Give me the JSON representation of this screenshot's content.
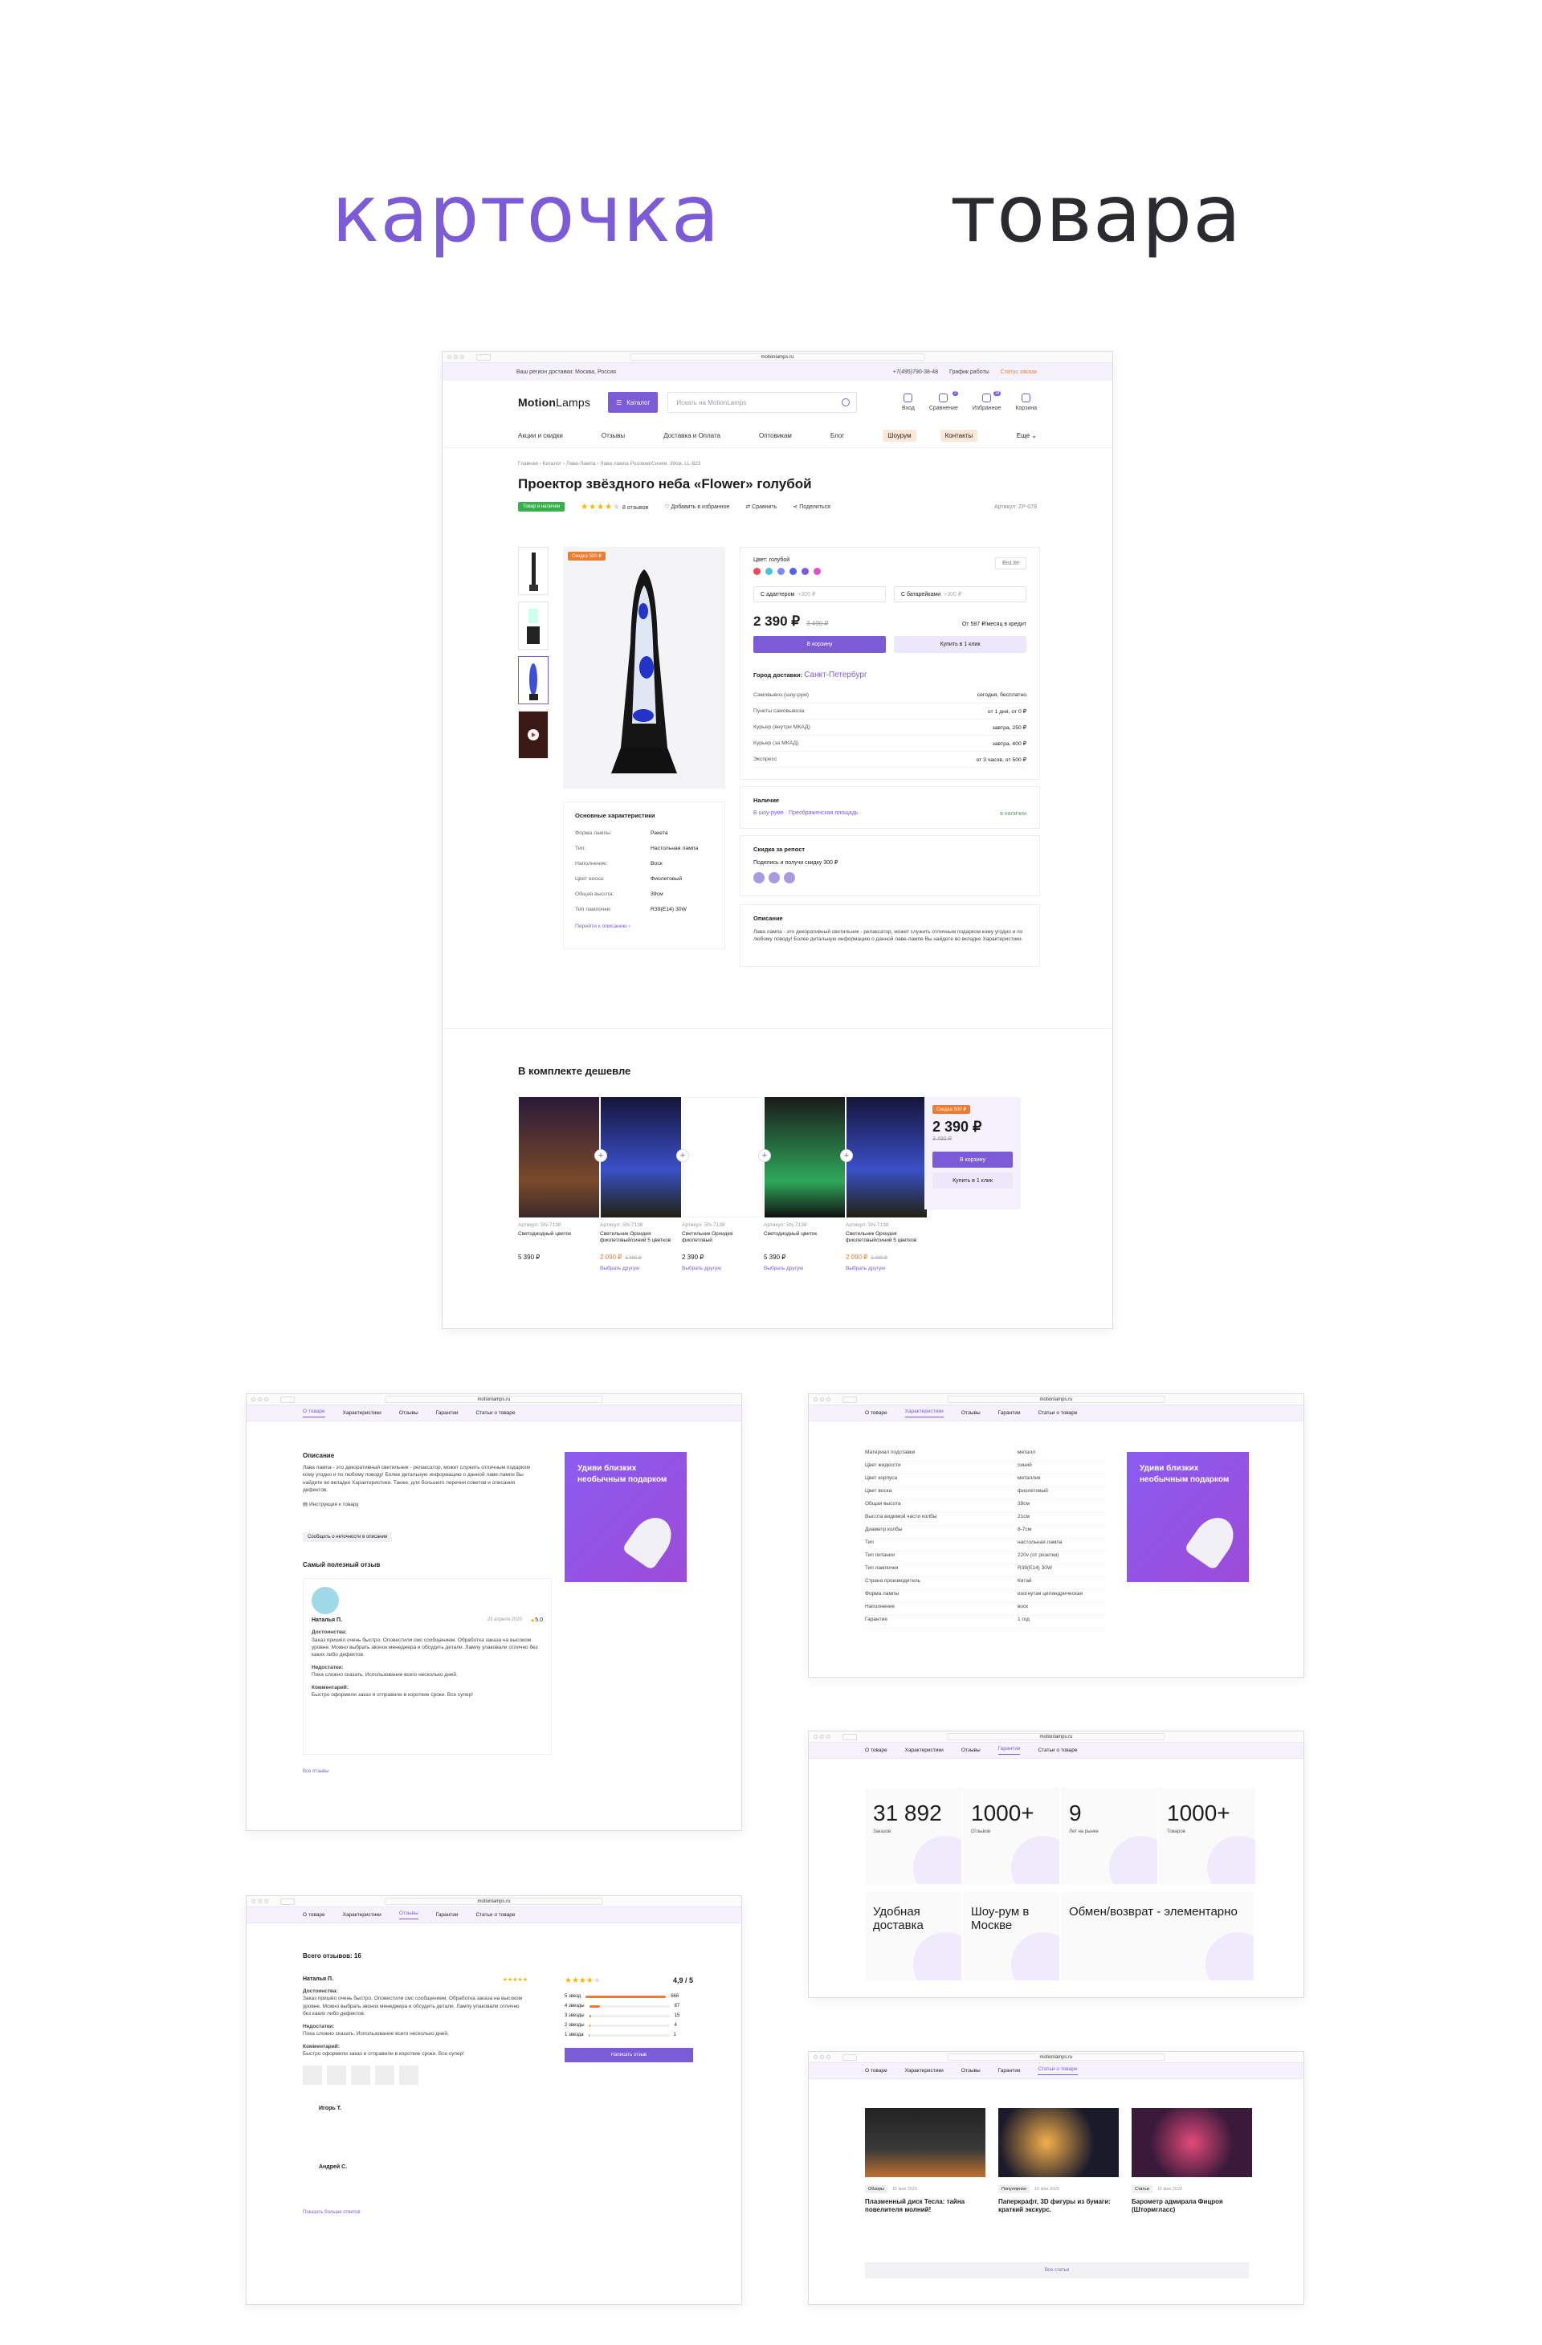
{
  "hero": {
    "word1": "карточка",
    "word2": "товара"
  },
  "url": "motionlamps.ru",
  "main": {
    "topbar": {
      "region": "Ваш регион доставки: Москва, Россия",
      "phone": "+7(495)790-38-48",
      "schedule": "График работы",
      "order": "Статус заказа"
    },
    "header": {
      "logo_a": "Motion",
      "logo_b": "Lamps",
      "catalog": "Каталог",
      "search_placeholder": "Искать на MotionLamps",
      "icons": [
        {
          "label": "Вход",
          "badge": ""
        },
        {
          "label": "Сравнение",
          "badge": "2"
        },
        {
          "label": "Избранное",
          "badge": "18"
        },
        {
          "label": "Корзина",
          "badge": ""
        }
      ]
    },
    "nav": [
      "Акции и скидки",
      "Отзывы",
      "Доставка и Оплата",
      "Оптовикам",
      "Блог"
    ],
    "nav_pills": [
      "Шоурум",
      "Контакты"
    ],
    "nav_more": "Еще",
    "breadcrumbs": "Главная  ›  Каталог  ›  Лава-Лампа  ›  Лава лампа Розовая/Синяя, 39см, LL-823",
    "title": "Проектор звёздного неба «Flower» голубой",
    "in_stock": "Товар в наличии",
    "rating": "4",
    "reviews": "8 отзывов",
    "fav": "Добавить в избранное",
    "compare": "Сравнить",
    "share": "Поделиться",
    "article": "Артикул: ZP-078",
    "discount_tag": "Скидка 500 ₽",
    "characteristics": {
      "title": "Основные характеристики",
      "rows": [
        [
          "Форма лампы:",
          "Ракета"
        ],
        [
          "Тип:",
          "Настольная лампа"
        ],
        [
          "Наполнение:",
          "Воск"
        ],
        [
          "Цвет воска:",
          "Фиолетовый"
        ],
        [
          "Общая высота:",
          "39см"
        ],
        [
          "Тип лампочки:",
          "R39(E14) 30W"
        ]
      ],
      "link": "Перейти к описанию  ›"
    },
    "buy": {
      "color_label": "Цвет: голубой",
      "brand": "BisLite",
      "colors": [
        "#e84a5f",
        "#43c6dc",
        "#7d8bf0",
        "#5561e6",
        "#7b5cd6",
        "#e24fcb"
      ],
      "opt1": "С адаптером",
      "opt1p": "+300 ₽",
      "opt2": "С батарейками",
      "opt2p": "+300 ₽",
      "price": "2 390 ₽",
      "old_price": "3 490 ₽",
      "credit": "От 587 ₽/месяц в кредит",
      "cart": "В корзину",
      "one_click": "Купить в 1 клик",
      "city_label": "Город доставки:",
      "city": "Санкт-Петербург",
      "delivery": [
        [
          "Самовывоз (шоу-рум)",
          "сегодня, бесплатно"
        ],
        [
          "Пункты самовывоза",
          "от 1 дня, от 0 ₽"
        ],
        [
          "Курьер (внутри МКАД)",
          "завтра, 250 ₽"
        ],
        [
          "Курьер (за МКАД)",
          "завтра, 400 ₽"
        ],
        [
          "Экспресс",
          "от 3 часов, от 500 ₽"
        ]
      ]
    },
    "availability": {
      "title": "Наличие",
      "place": "В шоу-руме  ·  Преображенская площадь",
      "status": "в наличии"
    },
    "repost": {
      "title": "Скидка за репост",
      "text": "Поделись и получи скидку 300 ₽"
    },
    "description": {
      "title": "Описание",
      "text": "Лава лампа - это декоративный светильник - релаксатор, может служить отличным подарком кому угодно и по любому поводу! Более детальную информацию о данной лаве-лампе Вы найдете во вкладке Характеристики."
    },
    "bundle": {
      "title": "В комплекте дешевле",
      "items": [
        {
          "art": "Артикул: SN-7138",
          "name": "Светодиодный цветок",
          "price": "5 390 ₽",
          "old": "",
          "choose": ""
        },
        {
          "art": "Артикул: SN-7138",
          "name": "Светильник Орхидея фиолетовый/синий 5 цветков",
          "price": "2 090 ₽",
          "old": "3 490 ₽",
          "choose": "Выбрать другую"
        },
        {
          "art": "Артикул: SN-7138",
          "name": "Светильник Орхидея фиолетовый",
          "price": "2 390 ₽",
          "old": "",
          "choose": "Выбрать другую"
        },
        {
          "art": "Артикул: SN-7138",
          "name": "Светодиодный цветок",
          "price": "5 390 ₽",
          "old": "",
          "choose": "Выбрать другую"
        },
        {
          "art": "Артикул: SN-7138",
          "name": "Светильник Орхидея фиолетовый/синий 5 цветков",
          "price": "2 090 ₽",
          "old": "3 490 ₽",
          "choose": "Выбрать другую"
        }
      ],
      "sum_tag": "Скидка 500 ₽",
      "sum_price": "2 390 ₽",
      "sum_old": "3 490 ₽",
      "cart": "В корзину",
      "one_click": "Купить в 1 клик"
    }
  },
  "tabs": [
    "О товаре",
    "Характеристики",
    "Отзывы",
    "Гарантии",
    "Статьи о товаре"
  ],
  "promo": "Удиви близких необычным подарком",
  "s1": {
    "desc_title": "Описание",
    "desc": "Лава лампа - это декоративный светильник - релаксатор, может служить отличным подарком кому угодно и по любому поводу! Более детальную информацию о данной лаве-лампе Вы найдете во вкладке Характеристики. Также, для большего перечня советов и описания дефектов.",
    "instr": "Инструкция к товару",
    "report": "Сообщить о неточности в описании",
    "best": "Самый полезный отзыв",
    "name": "Наталья П.",
    "date": "23 апреля 2020",
    "score": "5.0",
    "adv": "Достоинства:",
    "adv_t": "Заказ пришёл очень быстро. Оповестили смс сообщением. Обработка заказа на высоком уровне. Можно выбрать звонок менеджера и обсудить детали. Лампу упаковали отлично без каких либо дефектов.",
    "dis": "Недостатки:",
    "dis_t": "Пока сложно сказать. Использование всего несколько дней.",
    "com": "Комментарий:",
    "com_t": "Быстро оформили заказ и отправили в короткие сроки. Все супер!",
    "all": "Все отзывы"
  },
  "s2": {
    "rows": [
      [
        "Материал подставки",
        "металл"
      ],
      [
        "Цвет жидкости",
        "синий"
      ],
      [
        "Цвет корпуса",
        "металлик"
      ],
      [
        "Цвет воска",
        "фиолетовый"
      ],
      [
        "Общая высота",
        "39см"
      ],
      [
        "Высота видимой части колбы",
        "21см"
      ],
      [
        "Диаметр колбы",
        "8-7см"
      ],
      [
        "Тип",
        "настольная лампа"
      ],
      [
        "Тип питания",
        "220v (от розетки)"
      ],
      [
        "Тип лампочки",
        "R39(E14) 30W"
      ],
      [
        "Страна производитель",
        "Китай"
      ],
      [
        "Форма лампы",
        "изогнутая цилиндрическая"
      ],
      [
        "Наполнение",
        "воск"
      ],
      [
        "Гарантия",
        "1 год"
      ]
    ]
  },
  "s3": {
    "total": "Всего отзывов: 16",
    "name": "Наталья П.",
    "score": "4,9 / 5",
    "counts": [
      [
        "5 звезд",
        "666"
      ],
      [
        "4 звезды",
        "87"
      ],
      [
        "3 звезды",
        "15"
      ],
      [
        "2 звезды",
        "4"
      ],
      [
        "1 звезда",
        "1"
      ]
    ],
    "btn": "Написать отзыв",
    "r2": "Игорь Т.",
    "r3": "Андрей С.",
    "more": "Показать больше ответов"
  },
  "s4": {
    "stats": [
      [
        "31 892",
        "Заказов"
      ],
      [
        "1000+",
        "Отзывов"
      ],
      [
        "9",
        "Лет на рынке"
      ],
      [
        "1000+",
        "Товаров"
      ]
    ],
    "feat": [
      "Удобная доставка",
      "Шоу-рум в Москве",
      "Обмен/возврат - элементарно"
    ]
  },
  "s5": {
    "articles": [
      {
        "tag": "Обзоры",
        "date": "15 мая 2020",
        "title": "Плазменный диск Тесла: тайна повелителя молний!"
      },
      {
        "tag": "Популярное",
        "date": "15 мая 2020",
        "title": "Паперкрафт, 3D фигуры из бумаги: краткий экскурс."
      },
      {
        "tag": "Статьи",
        "date": "15 мая 2020",
        "title": "Барометр адмирала Фицроя (Штормгласс)"
      }
    ],
    "all": "Все статьи"
  }
}
